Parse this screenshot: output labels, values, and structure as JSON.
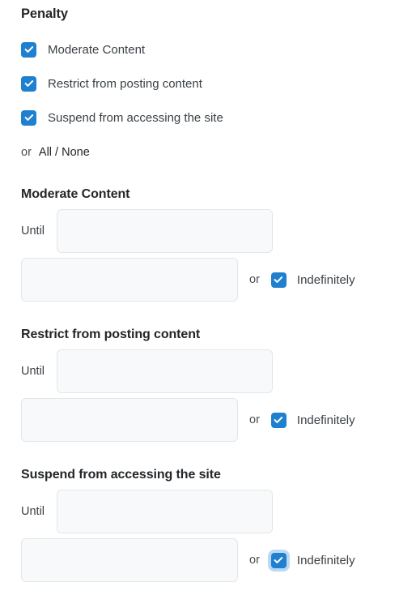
{
  "heading": "Penalty",
  "penalty_options": [
    {
      "label": "Moderate Content",
      "checked": true
    },
    {
      "label": "Restrict from posting content",
      "checked": true
    },
    {
      "label": "Suspend from accessing the site",
      "checked": true
    }
  ],
  "all_none": {
    "or_label": "or",
    "link_label": "All / None"
  },
  "common": {
    "until_label": "Until",
    "or_label": "or",
    "indefinitely_label": "Indefinitely"
  },
  "colors": {
    "checkbox_blue": "#2080d0",
    "focus_ring": "#bcd9f4",
    "input_bg": "#f8f9fa",
    "input_border": "#e3e6e8",
    "heading_text": "#232629",
    "body_text": "#3b4045"
  },
  "sections": [
    {
      "title": "Moderate Content",
      "until_value": "",
      "duration_value": "",
      "indefinitely_checked": true,
      "indefinitely_focused": false
    },
    {
      "title": "Restrict from posting content",
      "until_value": "",
      "duration_value": "",
      "indefinitely_checked": true,
      "indefinitely_focused": false
    },
    {
      "title": "Suspend from accessing the site",
      "until_value": "",
      "duration_value": "",
      "indefinitely_checked": true,
      "indefinitely_focused": true
    }
  ]
}
